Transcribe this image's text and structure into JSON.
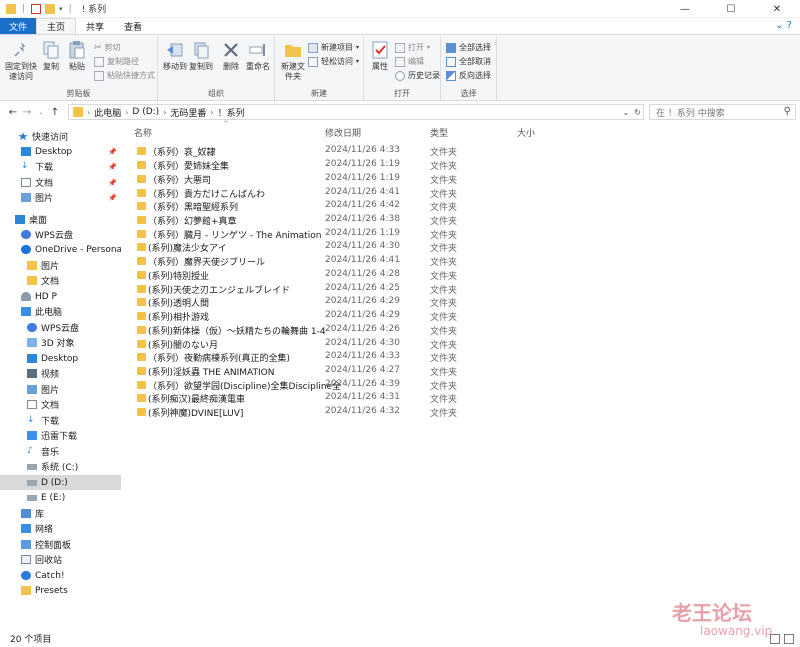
{
  "window": {
    "title": "系列",
    "title_prefix": "!",
    "minimize": "—",
    "maximize": "☐",
    "close": "✕"
  },
  "tabs": [
    {
      "label": "文件"
    },
    {
      "label": "主页"
    },
    {
      "label": "共享"
    },
    {
      "label": "查看"
    }
  ],
  "ribbon": {
    "clipboard": {
      "pin_label": "固定到快速访问",
      "copy_label": "复制",
      "paste_label": "粘贴",
      "cut_label": "剪切",
      "copy_path_label": "复制路径",
      "paste_shortcut_label": "粘贴快捷方式",
      "group_label": "剪贴板"
    },
    "organize": {
      "move_to_label": "移动到",
      "copy_to_label": "复制到",
      "delete_label": "删除",
      "rename_label": "重命名",
      "group_label": "组织"
    },
    "new": {
      "new_folder_label": "新建文件夹",
      "new_item_label": "新建项目",
      "easy_access_label": "轻松访问",
      "group_label": "新建"
    },
    "open": {
      "properties_label": "属性",
      "open_label": "打开",
      "edit_label": "编辑",
      "history_label": "历史记录",
      "group_label": "打开"
    },
    "select": {
      "select_all_label": "全部选择",
      "select_none_label": "全部取消",
      "invert_label": "反向选择",
      "group_label": "选择"
    }
  },
  "address": {
    "crumbs": [
      "此电脑",
      "D (D:)",
      "无码里番",
      "！系列"
    ],
    "search_placeholder": "在 ！系列 中搜索"
  },
  "navpane": {
    "items": [
      {
        "label": "快速访问"
      },
      {
        "label": "Desktop"
      },
      {
        "label": "下载"
      },
      {
        "label": "文档"
      },
      {
        "label": "图片"
      },
      {
        "label": "桌面"
      },
      {
        "label": "WPS云盘"
      },
      {
        "label": "OneDrive - Personal"
      },
      {
        "label": "图片"
      },
      {
        "label": "文档"
      },
      {
        "label": "HD P"
      },
      {
        "label": "此电脑"
      },
      {
        "label": "WPS云盘"
      },
      {
        "label": "3D 对象"
      },
      {
        "label": "Desktop"
      },
      {
        "label": "视频"
      },
      {
        "label": "图片"
      },
      {
        "label": "文档"
      },
      {
        "label": "下载"
      },
      {
        "label": "迅雷下载"
      },
      {
        "label": "音乐"
      },
      {
        "label": "系统 (C:)"
      },
      {
        "label": "D (D:)"
      },
      {
        "label": "E (E:)"
      },
      {
        "label": "库"
      },
      {
        "label": "网络"
      },
      {
        "label": "控制面板"
      },
      {
        "label": "回收站"
      },
      {
        "label": "Catch!"
      },
      {
        "label": "Presets"
      }
    ]
  },
  "columns": {
    "name": "名称",
    "date": "修改日期",
    "type": "类型",
    "size": "大小"
  },
  "files": [
    {
      "name": "（系列）哀_奴隷",
      "date": "2024/11/26 4:33",
      "type": "文件夹"
    },
    {
      "name": "（系列）愛姉妹全集",
      "date": "2024/11/26 1:19",
      "type": "文件夹"
    },
    {
      "name": "（系列）大悪司",
      "date": "2024/11/26 1:19",
      "type": "文件夹"
    },
    {
      "name": "（系列）貴方だけこんばんわ",
      "date": "2024/11/26 4:41",
      "type": "文件夹"
    },
    {
      "name": "（系列）黑暗聖經系列",
      "date": "2024/11/26 4:42",
      "type": "文件夹"
    },
    {
      "name": "（系列）幻夢館+真章",
      "date": "2024/11/26 4:38",
      "type": "文件夹"
    },
    {
      "name": "（系列）臓月 - リンゲツ - The Animation",
      "date": "2024/11/26 1:19",
      "type": "文件夹"
    },
    {
      "name": "(系列)魔法少女アイ",
      "date": "2024/11/26 4:30",
      "type": "文件夹"
    },
    {
      "name": "（系列）魔界天使ジブリール",
      "date": "2024/11/26 4:41",
      "type": "文件夹"
    },
    {
      "name": "(系列)特別授业",
      "date": "2024/11/26 4:28",
      "type": "文件夹"
    },
    {
      "name": "(系列)天使之刃エンジェルブレイド",
      "date": "2024/11/26 4:25",
      "type": "文件夹"
    },
    {
      "name": "(系列)透明人間",
      "date": "2024/11/26 4:29",
      "type": "文件夹"
    },
    {
      "name": "(系列)相扑游戏",
      "date": "2024/11/26 4:29",
      "type": "文件夹"
    },
    {
      "name": "(系列)新体操（仮）～妖精たちの輪舞曲 1-4",
      "date": "2024/11/26 4:26",
      "type": "文件夹"
    },
    {
      "name": "(系列)闇のない月",
      "date": "2024/11/26 4:30",
      "type": "文件夹"
    },
    {
      "name": "（系列）夜勤病棟系列(真正的全集)",
      "date": "2024/11/26 4:33",
      "type": "文件夹"
    },
    {
      "name": "(系列)淫妖蟲 THE ANIMATION",
      "date": "2024/11/26 4:27",
      "type": "文件夹"
    },
    {
      "name": "（系列）欲望学园(Discipline)全集Discipline全",
      "date": "2024/11/26 4:39",
      "type": "文件夹"
    },
    {
      "name": "(系列痴汉)最終痴漢電車",
      "date": "2024/11/26 4:31",
      "type": "文件夹"
    },
    {
      "name": "(系列神魔)DVINE[LUV]",
      "date": "2024/11/26 4:32",
      "type": "文件夹"
    }
  ],
  "status": {
    "count": "20 个项目"
  },
  "watermark": {
    "line1": "老王论坛",
    "line2": "laowang.vip"
  }
}
